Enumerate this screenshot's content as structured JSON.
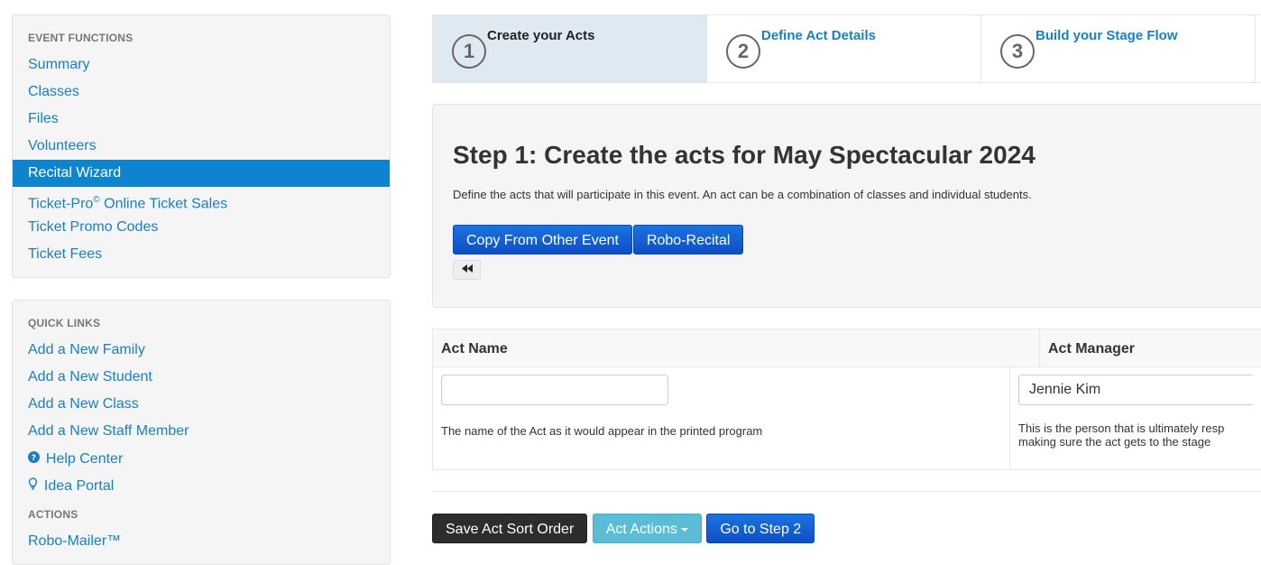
{
  "sidebar": {
    "event_functions": {
      "heading": "EVENT FUNCTIONS",
      "items": [
        {
          "label": "Summary"
        },
        {
          "label": "Classes"
        },
        {
          "label": "Files"
        },
        {
          "label": "Volunteers"
        },
        {
          "label": "Recital Wizard",
          "active": true
        },
        {
          "label": "Ticket-Pro",
          "sup": "©",
          "suffix": " Online Ticket Sales"
        },
        {
          "label": "Ticket Promo Codes"
        },
        {
          "label": "Ticket Fees"
        }
      ]
    },
    "quick_links": {
      "heading": "QUICK LINKS",
      "items": [
        {
          "label": "Add a New Family"
        },
        {
          "label": "Add a New Student"
        },
        {
          "label": "Add a New Class"
        },
        {
          "label": "Add a New Staff Member"
        },
        {
          "label": "Help Center",
          "icon": "question-circle-icon",
          "glyph": "❓"
        },
        {
          "label": "Idea Portal",
          "icon": "lightbulb-icon",
          "glyph": "💡"
        }
      ],
      "actions_heading": "ACTIONS",
      "actions": [
        {
          "label": "Robo-Mailer™"
        }
      ]
    }
  },
  "wizard": {
    "steps": [
      {
        "num": "1",
        "label": "Create your Acts",
        "active": true
      },
      {
        "num": "2",
        "label": "Define Act Details"
      },
      {
        "num": "3",
        "label": "Build your Stage Flow"
      }
    ]
  },
  "main": {
    "title": "Step 1: Create the acts for May Spectacular 2024",
    "description": "Define the acts that will participate in this event. An act can be a combination of classes and individual students.",
    "copy_button": "Copy From Other Event",
    "robo_button": "Robo-Recital",
    "collapse_glyph": "⏪"
  },
  "form": {
    "act_name_header": "Act Name",
    "act_manager_header": "Act Manager",
    "act_name_value": "",
    "act_name_help": "The name of the Act as it would appear in the printed program",
    "act_manager_value": "Jennie Kim",
    "act_manager_help_1": "This is the person that is ultimately resp",
    "act_manager_help_2": "making sure the act gets to the stage"
  },
  "footer": {
    "save_sort": "Save Act Sort Order",
    "act_actions": "Act Actions",
    "go_step2": "Go to Step 2"
  },
  "colors": {
    "link": "#1a7fc1",
    "active_nav": "#0e84cf",
    "primary": "#0d4fc4",
    "info": "#5bbcd6"
  }
}
